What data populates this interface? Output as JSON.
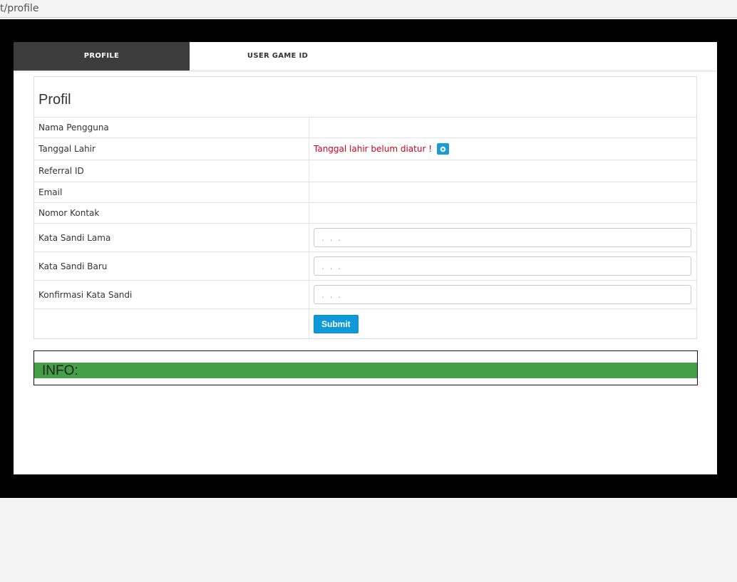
{
  "browser": {
    "url": "t/profile"
  },
  "tabs": [
    {
      "label": "PROFILE",
      "active": true
    },
    {
      "label": "USER GAME ID",
      "active": false
    }
  ],
  "profile": {
    "title": "Profil",
    "fields": {
      "username": {
        "label": "Nama Pengguna",
        "value": ""
      },
      "birthdate": {
        "label": "Tanggal Lahir",
        "value": "Tanggal lahir belum diatur !",
        "icon": "gear-icon"
      },
      "referral": {
        "label": "Referral ID",
        "value": ""
      },
      "email": {
        "label": "Email",
        "value": ""
      },
      "phone": {
        "label": "Nomor Kontak",
        "value": ""
      },
      "old_password": {
        "label": "Kata Sandi Lama",
        "placeholder": ". . ."
      },
      "new_password": {
        "label": "Kata Sandi Baru",
        "placeholder": ". . ."
      },
      "confirm_password": {
        "label": "Konfirmasi Kata Sandi",
        "placeholder": ". . ."
      }
    },
    "submit_label": "Submit"
  },
  "info": {
    "label": "INFO:"
  },
  "colors": {
    "tab_active_bg": "#3b3c3b",
    "warning": "#d0021b",
    "primary_button": "#0e9ad8",
    "info_bar": "#43a047"
  }
}
